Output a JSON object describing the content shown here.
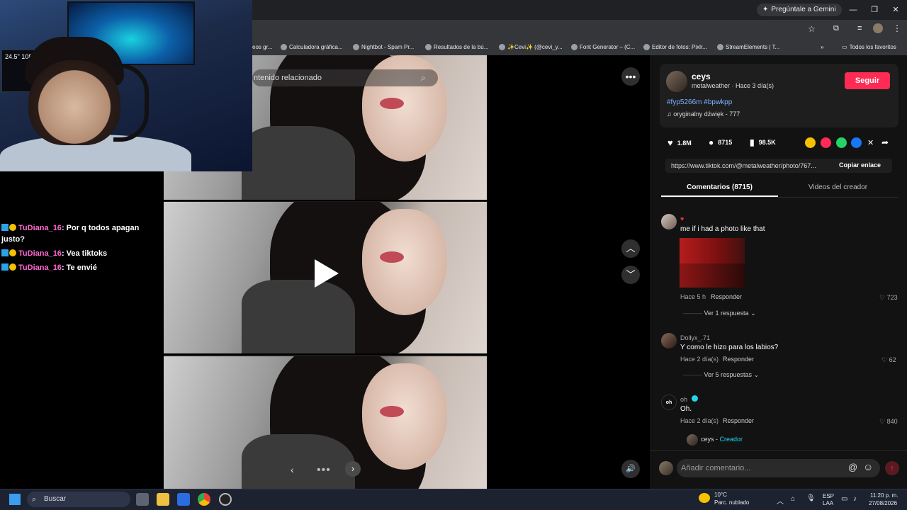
{
  "browser": {
    "gemini_label": "Pregúntale a Gemini",
    "bookmarks": [
      {
        "label": "eos gr..."
      },
      {
        "label": "Calculadora gráfica..."
      },
      {
        "label": "Nightbot - Spam Pr..."
      },
      {
        "label": "Resultados de la bú..."
      },
      {
        "label": "✨Cevi✨ (@cevi_y..."
      },
      {
        "label": "Font Generator – (C..."
      },
      {
        "label": "Editor de fotos: Pixlr..."
      },
      {
        "label": "StreamElements | T..."
      }
    ],
    "all_favorites": "Todos los favoritos"
  },
  "webcam": {
    "monitor_text": "24.5\" 1080p"
  },
  "chat": [
    {
      "user": "TuDiana_16",
      "message": ": Por q todos apagan justo?"
    },
    {
      "user": "TuDiana_16",
      "message": ": Vea tiktoks"
    },
    {
      "user": "TuDiana_16",
      "message": ": Te envié"
    }
  ],
  "feed": {
    "search_placeholder": "ntenido relacionado"
  },
  "post": {
    "username": "ceys",
    "meta": "metalweather · Hace 3 día(s)",
    "follow_label": "Seguir",
    "hashtags": "#fyp5266m #bpwkpp",
    "sound": "oryginalny dźwięk - 777",
    "likes": "1.8M",
    "comments": "8715",
    "saves": "98.5K",
    "link": "https://www.tiktok.com/@metalweather/photo/767...",
    "copy_label": "Copiar enlace",
    "tab_comments": "Comentarios (8715)",
    "tab_videos": "Videos del creador"
  },
  "comments": [
    {
      "name": "",
      "text": "me if i had a photo like that",
      "meta": "Hace 5 h",
      "reply": "Responder",
      "likes": "723",
      "more": "Ver 1 respuesta"
    },
    {
      "name": "Dollyx_.71",
      "text": "Y como le hizo para los labios?",
      "meta": "Hace 2 día(s)",
      "reply": "Responder",
      "likes": "62",
      "more": "Ver 5 respuestas"
    },
    {
      "name": "oh",
      "text": "Oh.",
      "meta": "Hace 2 día(s)",
      "reply": "Responder",
      "likes": "840"
    }
  ],
  "creator_reply": {
    "name": "ceys",
    "badge": "Creador"
  },
  "comment_input_placeholder": "Añadir comentario...",
  "taskbar": {
    "search": "Buscar",
    "weather_temp": "10°C",
    "weather_desc": "Parc. nublado",
    "lang1": "ESP",
    "lang2": "LAA",
    "time": "11:20 p. m.",
    "date": "27/08/2026"
  },
  "colors": {
    "accent": "#fe2c55",
    "hashtag": "#7bb5ff",
    "chat_user": "#ff69d1"
  }
}
